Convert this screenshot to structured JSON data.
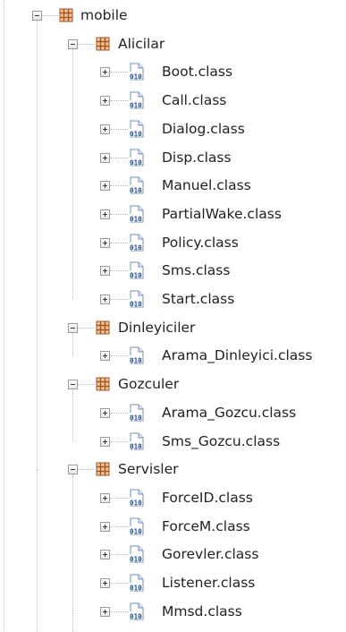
{
  "tree": {
    "root": {
      "label": "mobile",
      "expanded": true,
      "icon": "package-icon"
    },
    "packages": [
      {
        "label": "Alicilar",
        "expanded": true,
        "icon": "package-icon",
        "classes": [
          {
            "label": "Boot.class",
            "icon": "class-file-icon"
          },
          {
            "label": "Call.class",
            "icon": "class-file-icon"
          },
          {
            "label": "Dialog.class",
            "icon": "class-file-icon"
          },
          {
            "label": "Disp.class",
            "icon": "class-file-icon"
          },
          {
            "label": "Manuel.class",
            "icon": "class-file-icon"
          },
          {
            "label": "PartialWake.class",
            "icon": "class-file-icon"
          },
          {
            "label": "Policy.class",
            "icon": "class-file-icon"
          },
          {
            "label": "Sms.class",
            "icon": "class-file-icon"
          },
          {
            "label": "Start.class",
            "icon": "class-file-icon"
          }
        ]
      },
      {
        "label": "Dinleyiciler",
        "expanded": true,
        "icon": "package-icon",
        "classes": [
          {
            "label": "Arama_Dinleyici.class",
            "icon": "class-file-icon"
          }
        ]
      },
      {
        "label": "Gozculer",
        "expanded": true,
        "icon": "package-icon",
        "classes": [
          {
            "label": "Arama_Gozcu.class",
            "icon": "class-file-icon"
          },
          {
            "label": "Sms_Gozcu.class",
            "icon": "class-file-icon"
          }
        ]
      },
      {
        "label": "Servisler",
        "expanded": true,
        "icon": "package-icon",
        "classes": [
          {
            "label": "ForceID.class",
            "icon": "class-file-icon"
          },
          {
            "label": "ForceM.class",
            "icon": "class-file-icon"
          },
          {
            "label": "Gorevler.class",
            "icon": "class-file-icon"
          },
          {
            "label": "Listener.class",
            "icon": "class-file-icon"
          },
          {
            "label": "Mmsd.class",
            "icon": "class-file-icon"
          }
        ]
      }
    ],
    "colors": {
      "package_brown": "#a0522d",
      "package_fill": "#f3c48a",
      "class_blue": "#3a6fb5",
      "class_text": "#1c4e9a",
      "guide_line": "#b9b9b9"
    }
  }
}
